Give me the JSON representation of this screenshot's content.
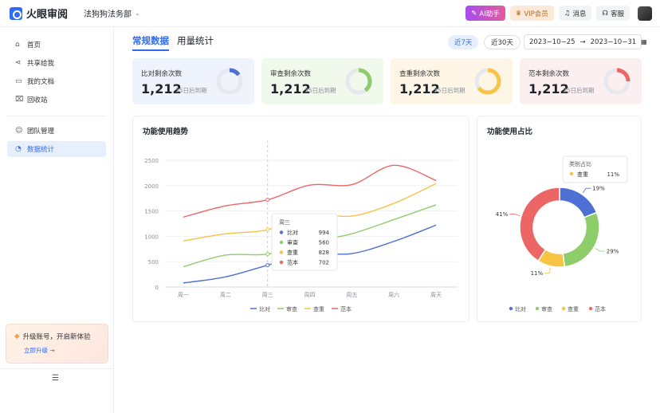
{
  "header": {
    "app_name": "火眼审阅",
    "org": "法狗狗法务部",
    "buttons": {
      "ai": "AI助手",
      "vip": "VIP会员",
      "msg": "消息",
      "service": "客服"
    }
  },
  "sidebar": {
    "items": [
      {
        "label": "首页"
      },
      {
        "label": "共享给我"
      },
      {
        "label": "我的文档"
      },
      {
        "label": "回收站"
      },
      {
        "label": "团队管理"
      },
      {
        "label": "数据统计"
      }
    ],
    "upgrade_title": "升级账号，开启新体验",
    "upgrade_link": "立即升级 →"
  },
  "tabs": {
    "active": "常规数据",
    "other": "用量统计"
  },
  "range": {
    "d7": "近7天",
    "d30": "近30天",
    "start": "2023−10−25",
    "arrow": "→",
    "end": "2023−10−31"
  },
  "cards": [
    {
      "label": "比对剩余次数",
      "value": "1,212",
      "sub": "35日后到期",
      "fraction": 0.15,
      "color": "#4e6fd3",
      "bg": "#eff3fc"
    },
    {
      "label": "审查剩余次数",
      "value": "1,212",
      "sub": "35日后到期",
      "fraction": 0.4,
      "color": "#8dce6a",
      "bg": "#f1f8ec"
    },
    {
      "label": "查重剩余次数",
      "value": "1,212",
      "sub": "35日后到期",
      "fraction": 0.65,
      "color": "#f7c444",
      "bg": "#fdf6e7"
    },
    {
      "label": "范本剩余次数",
      "value": "1,212",
      "sub": "35日后到期",
      "fraction": 0.25,
      "color": "#ec6666",
      "bg": "#fcefef"
    }
  ],
  "trend_title": "功能使用趋势",
  "share_title": "功能使用占比",
  "chart_data": [
    {
      "type": "line",
      "title": "功能使用趋势",
      "categories": [
        "周一",
        "周二",
        "周三",
        "周四",
        "周五",
        "周六",
        "周天"
      ],
      "ylim": [
        0,
        2500
      ],
      "yticks": [
        0,
        500,
        1000,
        1500,
        2000,
        2500
      ],
      "grid": true,
      "legend_position": "bottom",
      "series": [
        {
          "name": "比对",
          "color": "#4e6fd3",
          "values": [
            80,
            200,
            430,
            650,
            660,
            900,
            1220
          ]
        },
        {
          "name": "审查",
          "color": "#8dce6a",
          "values": [
            400,
            630,
            650,
            880,
            1050,
            1330,
            1620
          ]
        },
        {
          "name": "查重",
          "color": "#f7c444",
          "values": [
            910,
            1050,
            1130,
            1430,
            1400,
            1650,
            2040
          ]
        },
        {
          "name": "范本",
          "color": "#ec6666",
          "values": [
            1380,
            1600,
            1720,
            2010,
            2020,
            2400,
            2100
          ]
        }
      ],
      "tooltip": {
        "category": "周三",
        "rows": [
          {
            "name": "比对",
            "value": "994"
          },
          {
            "name": "审查",
            "value": "560"
          },
          {
            "name": "查重",
            "value": "828"
          },
          {
            "name": "范本",
            "value": "702"
          }
        ]
      }
    },
    {
      "type": "pie",
      "title": "功能使用占比",
      "legend_position": "bottom",
      "slices": [
        {
          "name": "比对",
          "value": 19,
          "label": "19%",
          "color": "#4e6fd3"
        },
        {
          "name": "审查",
          "value": 29,
          "label": "29%",
          "color": "#8dce6a"
        },
        {
          "name": "查重",
          "value": 11,
          "label": "11%",
          "color": "#f7c444"
        },
        {
          "name": "范本",
          "value": 41,
          "label": "41%",
          "color": "#ec6666"
        }
      ],
      "tooltip": {
        "title": "类别占比",
        "name": "查重",
        "value": "11%"
      }
    }
  ]
}
